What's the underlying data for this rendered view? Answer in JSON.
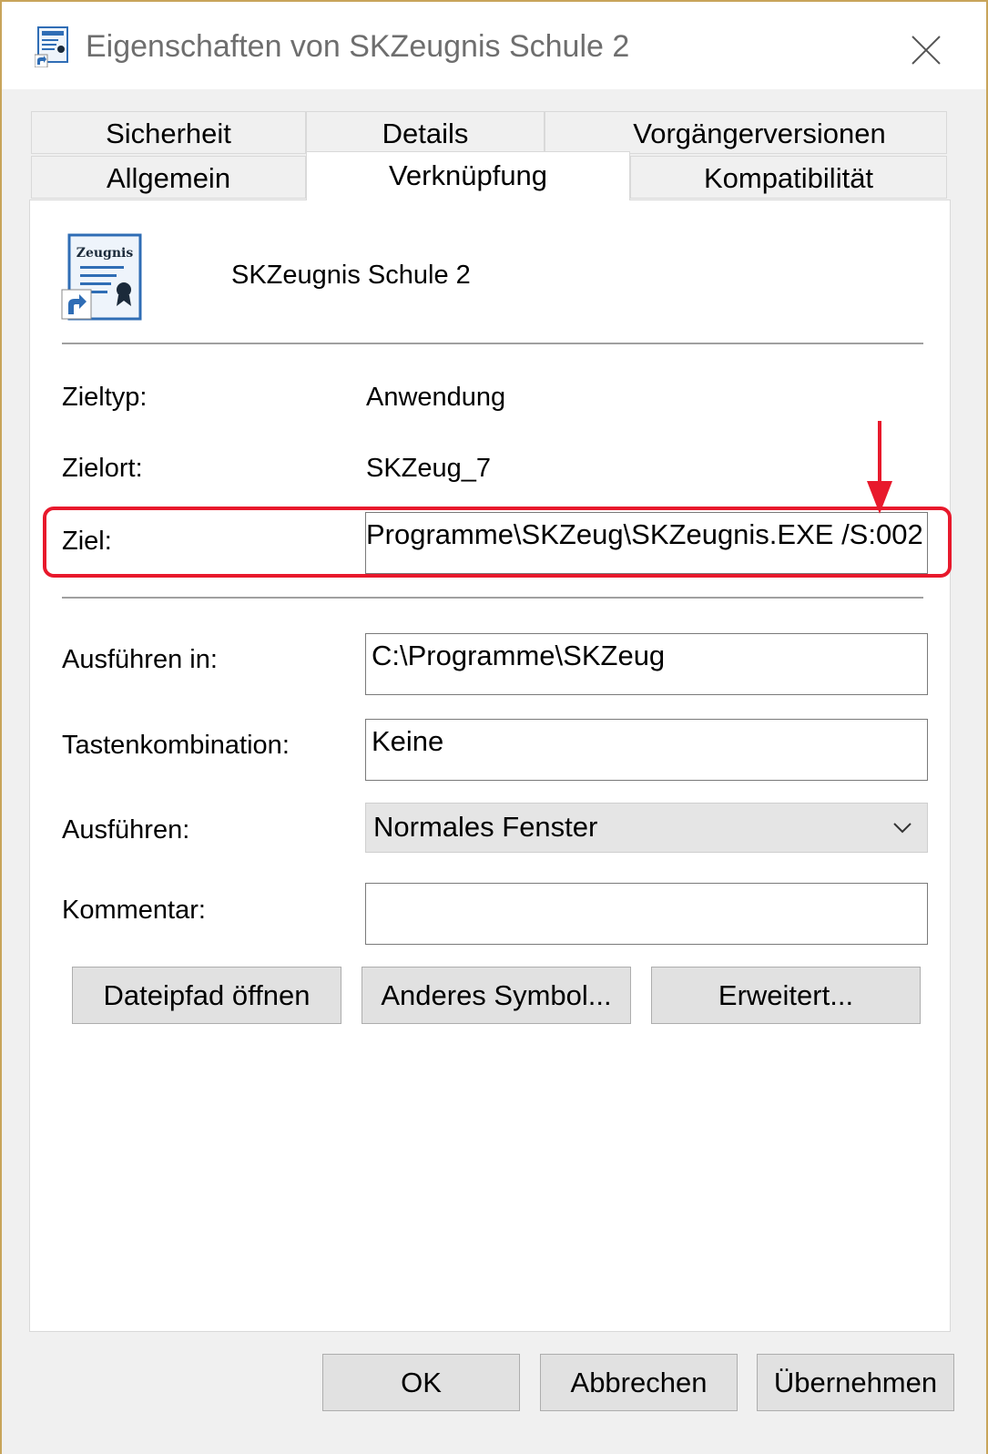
{
  "window": {
    "title": "Eigenschaften von SKZeugnis Schule 2",
    "app_icon": "zeugnis-document-icon",
    "close_icon": "close-icon"
  },
  "tabs": {
    "row_top": [
      "Sicherheit",
      "Details",
      "Vorgängerversionen"
    ],
    "row_bottom": [
      "Allgemein",
      "Verknüpfung",
      "Kompatibilität"
    ],
    "active": "Verknüpfung"
  },
  "shortcut": {
    "icon_label": "Zeugnis",
    "name": "SKZeugnis Schule 2"
  },
  "fields": {
    "zieltyp_label": "Zieltyp:",
    "zieltyp_value": "Anwendung",
    "zielort_label": "Zielort:",
    "zielort_value": "SKZeug_7",
    "ziel_label": "Ziel:",
    "ziel_value": "Programme\\SKZeug\\SKZeugnis.EXE /S:002",
    "ausfuehren_in_label": "Ausführen in:",
    "ausfuehren_in_value": "C:\\Programme\\SKZeug",
    "tastenkombination_label": "Tastenkombination:",
    "tastenkombination_value": "Keine",
    "ausfuehren_label": "Ausführen:",
    "ausfuehren_value": "Normales Fenster",
    "kommentar_label": "Kommentar:",
    "kommentar_value": ""
  },
  "buttons": {
    "dateipfad": "Dateipfad öffnen",
    "symbol": "Anderes Symbol...",
    "erweitert": "Erweitert...",
    "ok": "OK",
    "abbrechen": "Abbrechen",
    "uebernehmen": "Übernehmen"
  },
  "colors": {
    "annotation": "#e8192c",
    "window_border": "#c8a45a"
  }
}
